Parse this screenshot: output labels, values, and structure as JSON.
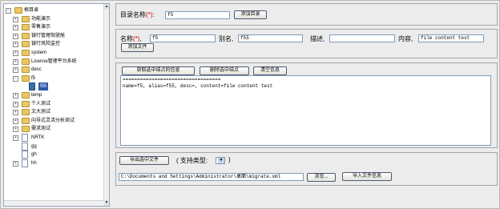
{
  "tree": {
    "items": [
      {
        "label": "根目录",
        "depth": 0,
        "expander": "−",
        "icon": "folder-icon"
      },
      {
        "label": "功能演示",
        "depth": 1,
        "expander": "+",
        "icon": "folder-icon"
      },
      {
        "label": "零售演示",
        "depth": 1,
        "expander": "+",
        "icon": "folder-icon"
      },
      {
        "label": "银行管理驾驶舱",
        "depth": 1,
        "expander": "+",
        "icon": "folder-icon"
      },
      {
        "label": "银行风险监控",
        "depth": 1,
        "expander": "+",
        "icon": "folder-icon"
      },
      {
        "label": "system",
        "depth": 1,
        "expander": "+",
        "icon": "folder-icon"
      },
      {
        "label": "License管理平台系统",
        "depth": 1,
        "expander": "+",
        "icon": "folder-icon"
      },
      {
        "label": "desc",
        "depth": 1,
        "expander": "+",
        "icon": "folder-icon"
      },
      {
        "label": "f5",
        "depth": 1,
        "expander": "−",
        "icon": "folder-icon"
      },
      {
        "label": "f55",
        "depth": 2,
        "expander": "",
        "icon": "file-icon",
        "selected": true
      },
      {
        "label": "temp",
        "depth": 1,
        "expander": "+",
        "icon": "folder-icon"
      },
      {
        "label": "个人测试",
        "depth": 1,
        "expander": "+",
        "icon": "folder-icon"
      },
      {
        "label": "文大测试",
        "depth": 1,
        "expander": "+",
        "icon": "folder-icon"
      },
      {
        "label": "向导式灵活分析测试",
        "depth": 1,
        "expander": "+",
        "icon": "folder-icon"
      },
      {
        "label": "需求测试",
        "depth": 1,
        "expander": "+",
        "icon": "folder-icon"
      },
      {
        "label": "NRTK",
        "depth": 1,
        "expander": "+",
        "icon": "file-icon"
      },
      {
        "label": "gg",
        "depth": 1,
        "expander": "",
        "icon": "file-icon"
      },
      {
        "label": "gh",
        "depth": 1,
        "expander": "",
        "icon": "file-icon"
      },
      {
        "label": "hh",
        "depth": 1,
        "expander": "+",
        "icon": "file-icon"
      }
    ]
  },
  "dir_panel": {
    "name_label": "目录名称",
    "required_mark": "(*)",
    "colon": ":",
    "name_value": "f5",
    "add_button": "添加目录"
  },
  "file_panel": {
    "name_label": "名称",
    "required_mark": "(*)",
    "colon": ",",
    "name_value": "f5",
    "alias_label": "别名,",
    "alias_value": "f55",
    "desc_label": "描述,",
    "desc_value": "",
    "content_label": "内容,",
    "content_value": "file content test",
    "add_button": "添加文件"
  },
  "info_panel": {
    "get_info_button": "获取选中结点的信息",
    "delete_button": "删除选中结点",
    "clear_button": "清空信息",
    "output_lines": [
      "==================================",
      "name=f5, alias=f55, desc=, content=file content test"
    ]
  },
  "export_panel": {
    "export_button": "导出选中文件",
    "support_label": "( 支持类型:",
    "support_close": ")",
    "path_value": "C:\\Documents and Settings\\Administrator\\桌面\\migrate.xml",
    "browse_button": "浏览...",
    "import_button": "导入文件信息"
  }
}
